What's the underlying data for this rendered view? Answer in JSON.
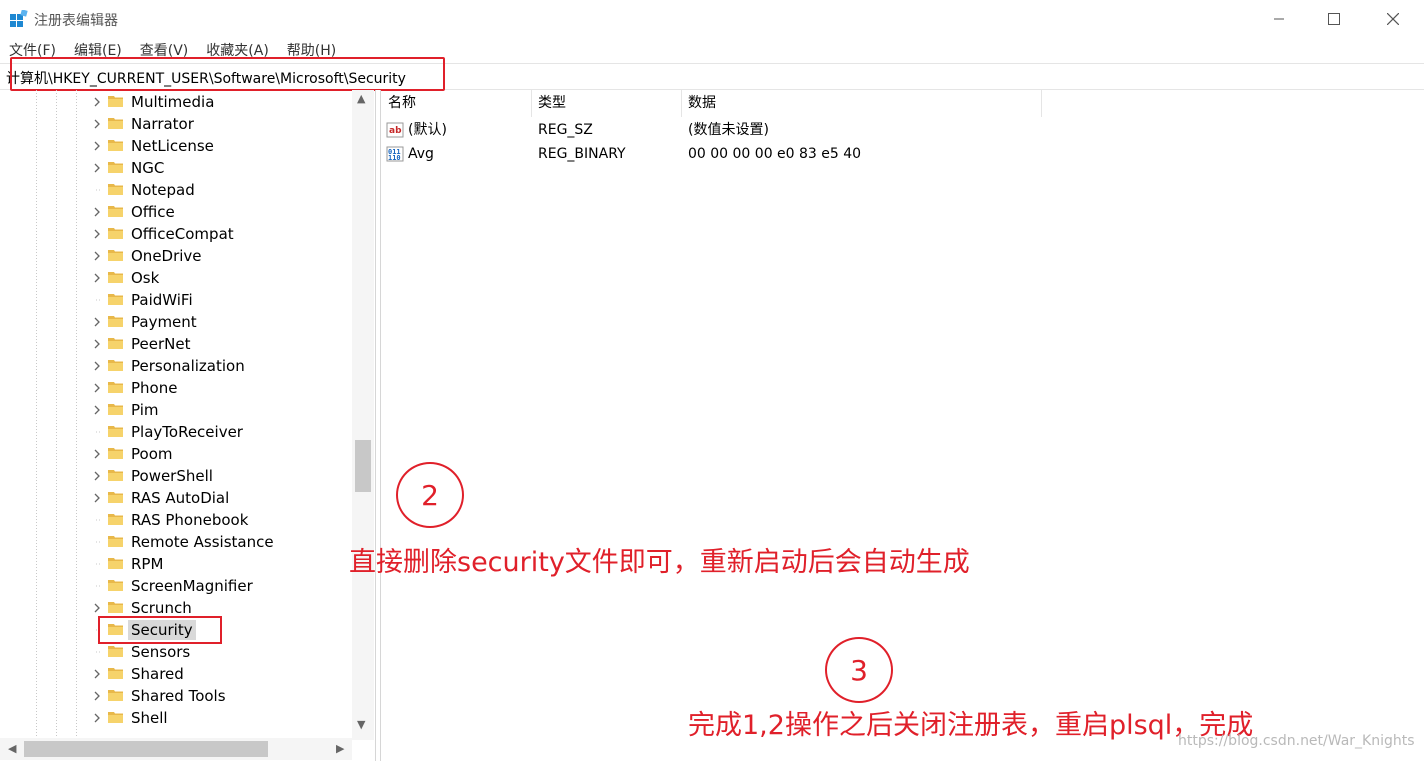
{
  "window": {
    "title": "注册表编辑器",
    "controls": {
      "minimize": "minimize-icon",
      "maximize": "maximize-icon",
      "close": "close-icon"
    }
  },
  "menu": {
    "items": [
      "文件(F)",
      "编辑(E)",
      "查看(V)",
      "收藏夹(A)",
      "帮助(H)"
    ]
  },
  "address": {
    "path": "计算机\\HKEY_CURRENT_USER\\Software\\Microsoft\\Security"
  },
  "tree": {
    "items": [
      {
        "label": "Multimedia",
        "expandable": true
      },
      {
        "label": "Narrator",
        "expandable": true
      },
      {
        "label": "NetLicense",
        "expandable": true
      },
      {
        "label": "NGC",
        "expandable": true
      },
      {
        "label": "Notepad",
        "expandable": false
      },
      {
        "label": "Office",
        "expandable": true
      },
      {
        "label": "OfficeCompat",
        "expandable": true
      },
      {
        "label": "OneDrive",
        "expandable": true
      },
      {
        "label": "Osk",
        "expandable": true
      },
      {
        "label": "PaidWiFi",
        "expandable": false
      },
      {
        "label": "Payment",
        "expandable": true
      },
      {
        "label": "PeerNet",
        "expandable": true
      },
      {
        "label": "Personalization",
        "expandable": true
      },
      {
        "label": "Phone",
        "expandable": true
      },
      {
        "label": "Pim",
        "expandable": true
      },
      {
        "label": "PlayToReceiver",
        "expandable": false
      },
      {
        "label": "Poom",
        "expandable": true
      },
      {
        "label": "PowerShell",
        "expandable": true
      },
      {
        "label": "RAS AutoDial",
        "expandable": true
      },
      {
        "label": "RAS Phonebook",
        "expandable": false
      },
      {
        "label": "Remote Assistance",
        "expandable": false
      },
      {
        "label": "RPM",
        "expandable": false
      },
      {
        "label": "ScreenMagnifier",
        "expandable": false
      },
      {
        "label": "Scrunch",
        "expandable": true
      },
      {
        "label": "Security",
        "expandable": false,
        "selected": true
      },
      {
        "label": "Sensors",
        "expandable": false
      },
      {
        "label": "Shared",
        "expandable": true
      },
      {
        "label": "Shared Tools",
        "expandable": true
      },
      {
        "label": "Shell",
        "expandable": true
      }
    ]
  },
  "values": {
    "headers": {
      "name": "名称",
      "type": "类型",
      "data": "数据"
    },
    "rows": [
      {
        "name": "(默认)",
        "type": "REG_SZ",
        "data": "(数值未设置)",
        "icon": "string-value-icon"
      },
      {
        "name": "Avg",
        "type": "REG_BINARY",
        "data": "00 00 00 00 e0 83 e5 40",
        "icon": "binary-value-icon"
      }
    ]
  },
  "annotations": {
    "step2_number": "2",
    "step2_text": "直接删除security文件即可，重新启动后会自动生成",
    "step3_number": "3",
    "step3_text": "完成1,2操作之后关闭注册表，重启plsql，完成",
    "watermark": "https://blog.csdn.net/War_Knights",
    "highlight_color": "#e0202a"
  }
}
